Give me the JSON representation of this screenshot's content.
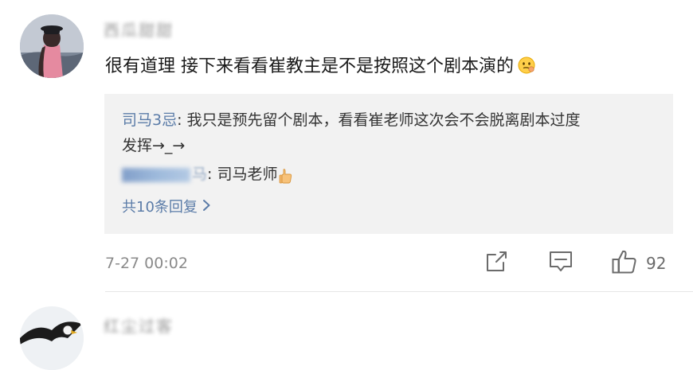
{
  "comment": {
    "username": "西瓜甜甜",
    "text": "很有道理  接下来看看崔教主是不是按照这个剧本演的",
    "time": "7-27 00:02",
    "like_count": "92",
    "emoji": "thinking-face"
  },
  "replies": [
    {
      "author": "司马3忌",
      "text": ": 我只是预先留个剧本，看看崔老师这次会不会脱离剧本过度",
      "continuation": "发挥→_→"
    },
    {
      "author_suffix": "马",
      "text": ": 司马老师",
      "emoji": "thumbs-up"
    }
  ],
  "more_replies_label": "共10条回复",
  "next_comment": {
    "username": "红尘过客"
  },
  "colors": {
    "link": "#5b7ca8",
    "reply_bg": "#f2f2f2",
    "meta": "#8a8a8a"
  },
  "icons": [
    "share-icon",
    "comment-icon",
    "like-icon",
    "chevron-right-icon"
  ]
}
